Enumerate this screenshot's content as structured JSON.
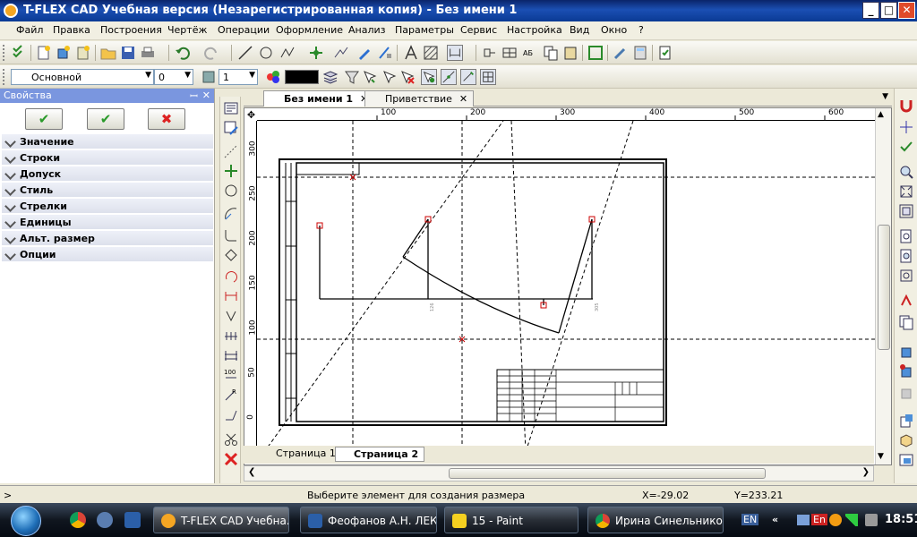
{
  "window": {
    "title": "T-FLEX CAD Учебная версия (Незарегистрированная копия) - Без имени 1",
    "controls": {
      "minimize": "_",
      "maximize": "□",
      "close": "✕"
    }
  },
  "menu": [
    "Файл",
    "Правка",
    "Построения",
    "Чертёж",
    "Операции",
    "Оформление",
    "Анализ",
    "Параметры",
    "Сервис",
    "Настройка",
    "Вид",
    "Окно",
    "?"
  ],
  "toolbar2": {
    "layer": "Основной",
    "layer_value": "0",
    "line_weight": "1"
  },
  "properties": {
    "title": "Свойства",
    "pin": "ꟷ",
    "close": "✕",
    "sections": [
      "Значение",
      "Строки",
      "Допуск",
      "Стиль",
      "Стрелки",
      "Единицы",
      "Альт. размер",
      "Опции"
    ]
  },
  "doc_tabs": [
    {
      "label": "Без имени 1",
      "close": "✕"
    },
    {
      "label": "Приветствие",
      "close": "✕"
    }
  ],
  "ruler": {
    "h_labels": [
      "100",
      "200",
      "300",
      "400",
      "500",
      "600"
    ],
    "v_labels": [
      "300",
      "250",
      "200",
      "150",
      "100",
      "50",
      "0"
    ]
  },
  "page_tabs": [
    "Страница 1",
    "Страница 2"
  ],
  "status": {
    "prompt": "Выберите элемент для создания размера",
    "x": "X=-29.02",
    "y": "Y=233.21",
    "left": ">"
  },
  "taskbar": {
    "tasks": [
      "T-FLEX CAD Учебна...",
      "Феофанов А.Н. ЛЕК...",
      "15 - Paint",
      "Ирина Синельнико..."
    ],
    "lang": "EN",
    "lang2": "En",
    "clock": "18:51",
    "chevron": "«"
  }
}
